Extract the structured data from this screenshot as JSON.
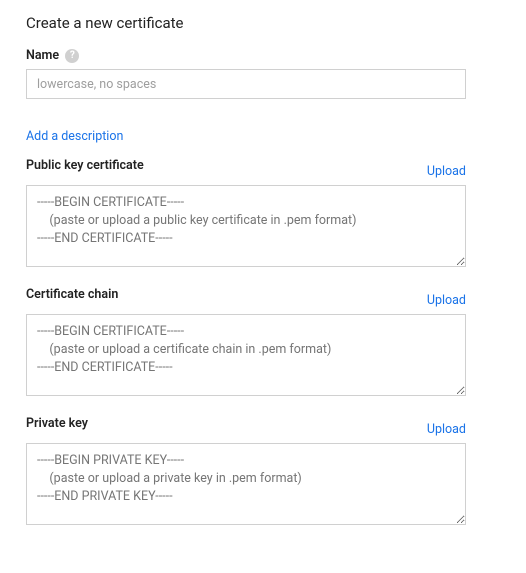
{
  "title": "Create a new certificate",
  "name_field": {
    "label": "Name",
    "placeholder": "lowercase, no spaces",
    "value": ""
  },
  "add_description_label": "Add a description",
  "public_key": {
    "label": "Public key certificate",
    "upload_label": "Upload",
    "placeholder": "-----BEGIN CERTIFICATE-----\n    (paste or upload a public key certificate in .pem format)\n-----END CERTIFICATE-----"
  },
  "cert_chain": {
    "label": "Certificate chain",
    "upload_label": "Upload",
    "placeholder": "-----BEGIN CERTIFICATE-----\n    (paste or upload a certificate chain in .pem format)\n-----END CERTIFICATE-----"
  },
  "private_key": {
    "label": "Private key",
    "upload_label": "Upload",
    "placeholder": "-----BEGIN PRIVATE KEY-----\n    (paste or upload a private key in .pem format)\n-----END PRIVATE KEY-----"
  }
}
